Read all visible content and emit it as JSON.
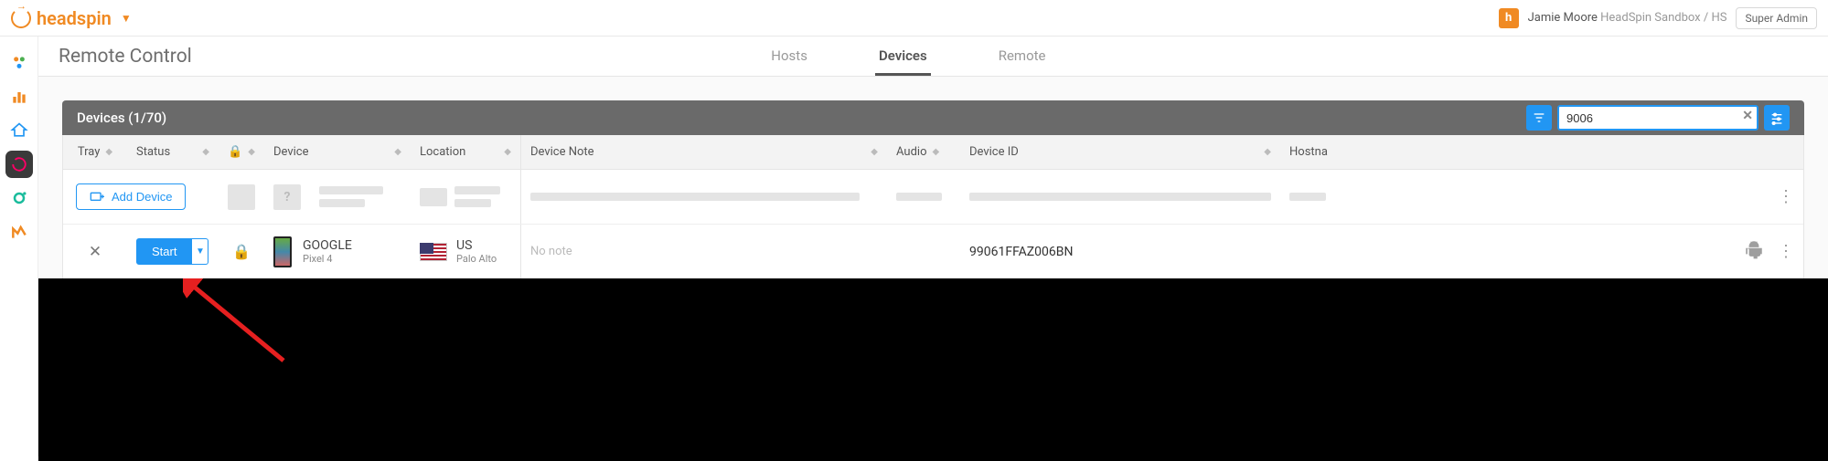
{
  "header": {
    "logo_text": "headspin",
    "user_name": "Jamie Moore",
    "org_text": "HeadSpin Sandbox / HS",
    "role_badge": "Super Admin"
  },
  "page": {
    "title": "Remote Control",
    "tabs": [
      {
        "label": "Hosts",
        "active": false
      },
      {
        "label": "Devices",
        "active": true
      },
      {
        "label": "Remote",
        "active": false
      }
    ]
  },
  "panel": {
    "title": "Devices (1/70)",
    "search_value": "9006"
  },
  "columns": {
    "tray": "Tray",
    "status": "Status",
    "device": "Device",
    "location": "Location",
    "note": "Device Note",
    "audio": "Audio",
    "device_id": "Device ID",
    "hostname": "Hostna"
  },
  "actions": {
    "add_device": "Add Device",
    "start": "Start"
  },
  "device_row": {
    "maker": "GOOGLE",
    "model": "Pixel 4",
    "country": "US",
    "city": "Palo Alto",
    "note": "No note",
    "device_id": "99061FFAZ006BN"
  }
}
